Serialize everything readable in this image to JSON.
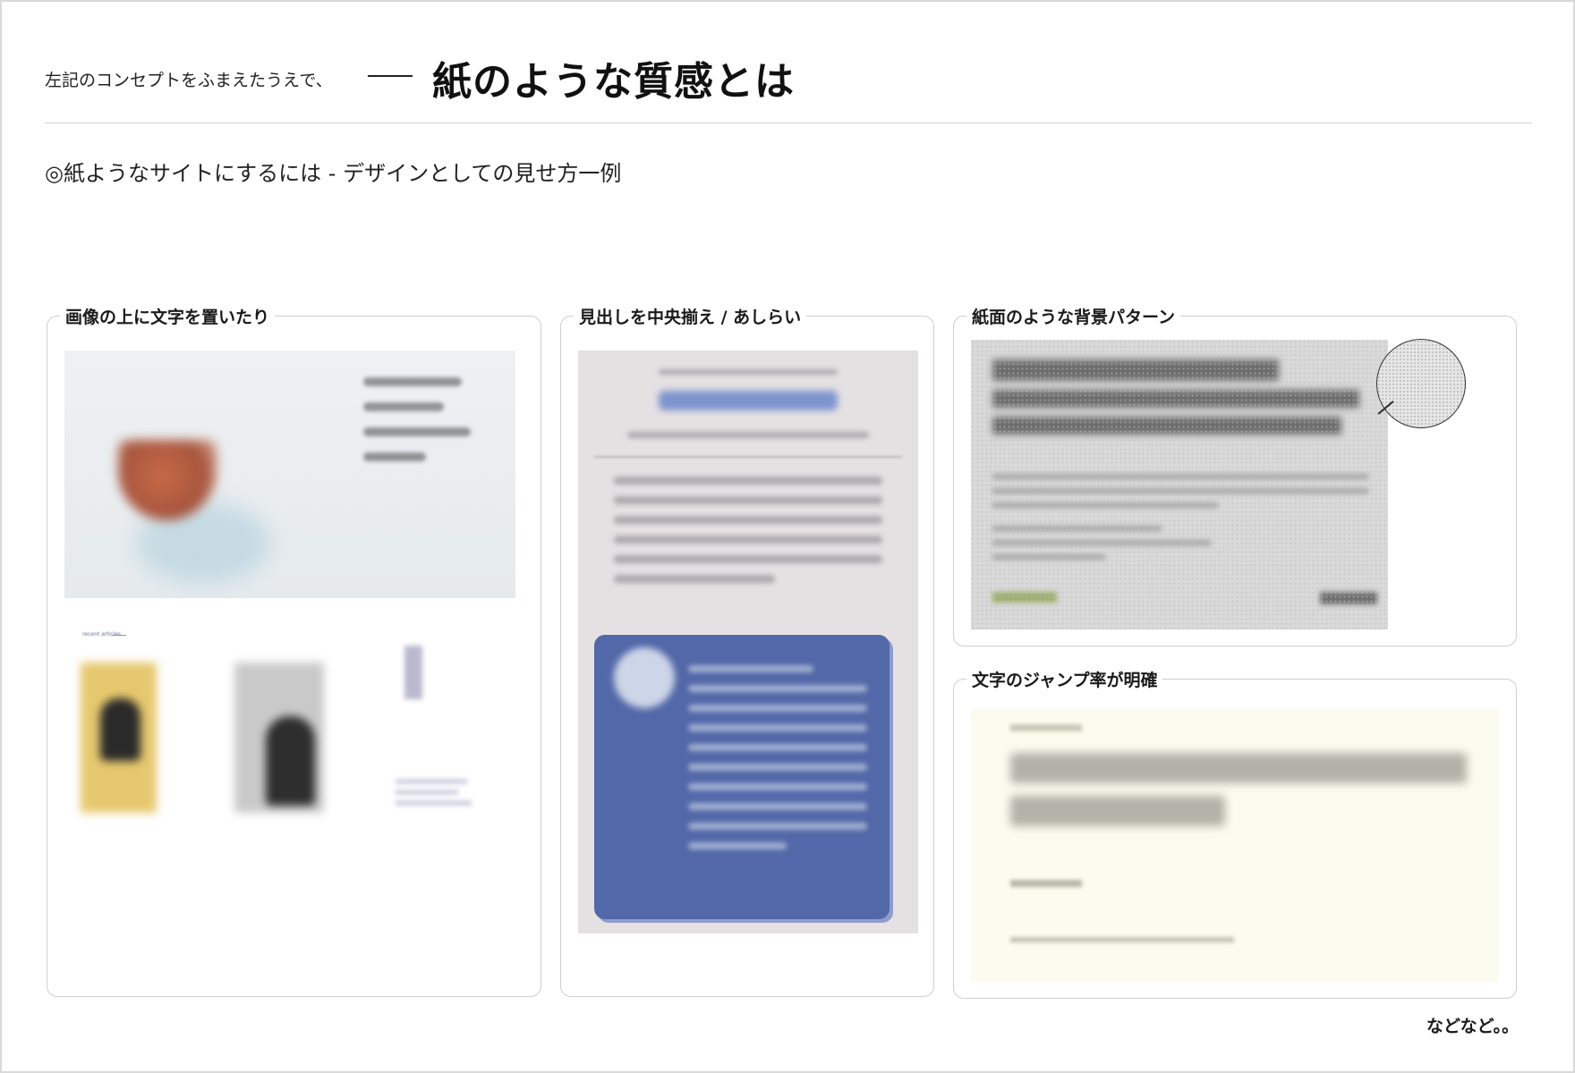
{
  "header": {
    "lead": "左記のコンセプトをふまえたうえで、",
    "title": "紙のような質感とは"
  },
  "subtitle": "◎紙ようなサイトにするには - デザインとしての見せ方一例",
  "panels": [
    {
      "label": "画像の上に文字を置いたり",
      "mini_label": "recent articles"
    },
    {
      "label": "見出しを中央揃え / あしらい"
    },
    {
      "label": "紙面のような背景パターン"
    },
    {
      "label": "文字のジャンプ率が明確"
    }
  ],
  "footer_note": "などなど。。",
  "colors": {
    "panel_border": "#cfcfcf",
    "blue_card": "#5268a8",
    "paper_gray": "#d9d9d9",
    "cream": "#fbfcef"
  }
}
